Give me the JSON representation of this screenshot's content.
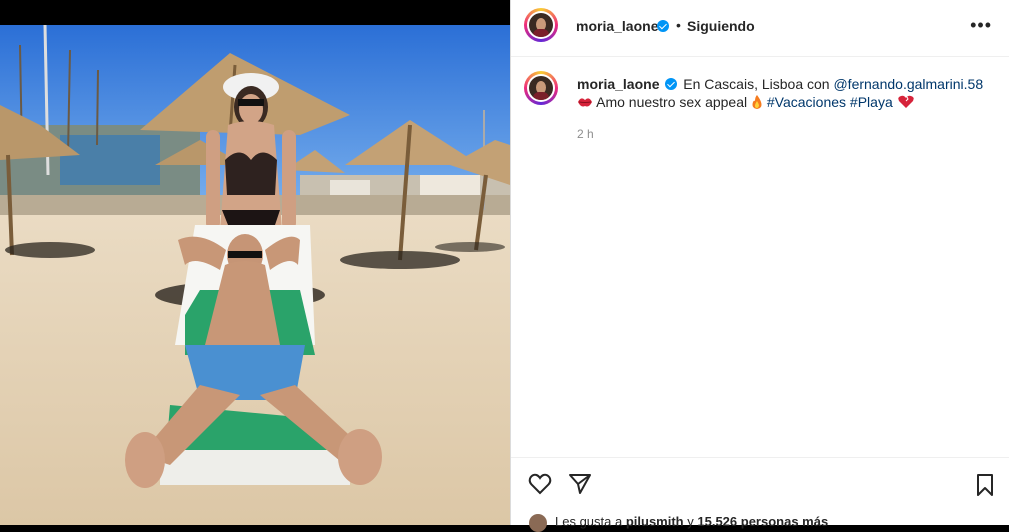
{
  "post": {
    "username": "moria_laone",
    "separator": "•",
    "follow_status": "Siguiendo",
    "more_label": "•••",
    "caption": {
      "location_prefix": "En Cascais, Lisboa con",
      "mention": "@fernando.galmarini.58",
      "text": "Amo nuestro sex appeal",
      "hashtag1": "#Vacaciones",
      "hashtag2": "#Playa"
    },
    "time_ago": "2 h",
    "likes": {
      "prefix": "Les gusta a",
      "user": "pilusmith",
      "middle": "y",
      "count": "15.526 personas más"
    }
  },
  "icons": {
    "like": "heart-icon",
    "share": "send-icon",
    "save": "bookmark-icon",
    "options": "ellipsis-icon",
    "verified": "verified-badge-icon"
  },
  "colors": {
    "link": "#00376b",
    "verified": "#0095f6",
    "text": "#262626",
    "muted": "#8e8e8e"
  }
}
